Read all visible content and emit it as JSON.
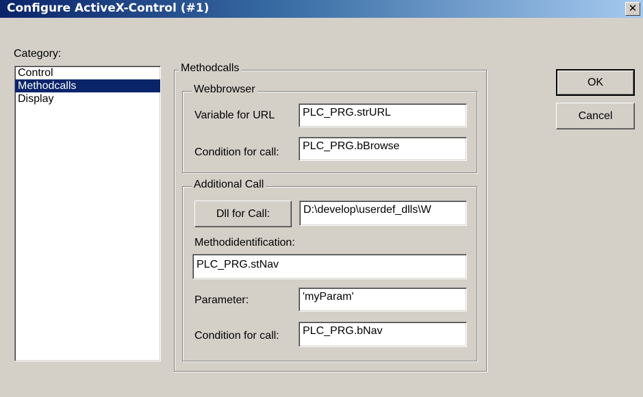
{
  "window": {
    "title": "Configure ActiveX-Control (#1)",
    "close_glyph": "✕"
  },
  "category": {
    "label": "Category:",
    "items": [
      "Control",
      "Methodcalls",
      "Display"
    ],
    "selected": "Methodcalls"
  },
  "methodcalls": {
    "group_label": "Methodcalls",
    "webbrowser": {
      "group_label": "Webbrowser",
      "variable_label": "Variable for URL",
      "variable_value": "PLC_PRG.strURL",
      "condition_label": "Condition for call:",
      "condition_value": "PLC_PRG.bBrowse"
    },
    "additional": {
      "group_label": "Additional Call",
      "dll_button": "Dll for Call:",
      "dll_value": "D:\\develop\\userdef_dlls\\W",
      "methodid_label": "Methodidentification:",
      "methodid_value": "PLC_PRG.stNav",
      "parameter_label": "Parameter:",
      "parameter_value": "'myParam'",
      "condition_label": "Condition for call:",
      "condition_value": "PLC_PRG.bNav"
    }
  },
  "buttons": {
    "ok": "OK",
    "cancel": "Cancel"
  }
}
